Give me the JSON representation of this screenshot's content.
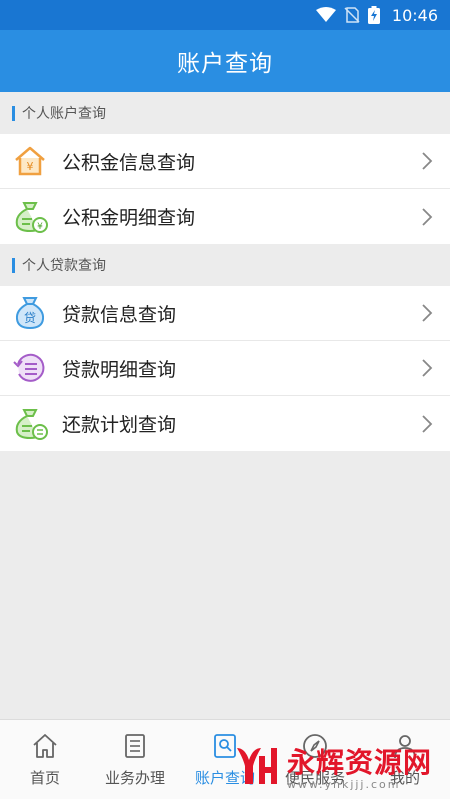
{
  "status_bar": {
    "time": "10:46"
  },
  "app_bar": {
    "title": "账户查询"
  },
  "sections": [
    {
      "title": "个人账户查询",
      "items": [
        {
          "label": "公积金信息查询",
          "icon": "house-yuan-icon"
        },
        {
          "label": "公积金明细查询",
          "icon": "money-bag-yuan-icon"
        }
      ]
    },
    {
      "title": "个人贷款查询",
      "items": [
        {
          "label": "贷款信息查询",
          "icon": "loan-bag-icon"
        },
        {
          "label": "贷款明细查询",
          "icon": "refresh-list-icon"
        },
        {
          "label": "还款计划查询",
          "icon": "repayment-bag-icon"
        }
      ]
    }
  ],
  "bottom_nav": {
    "items": [
      {
        "label": "首页",
        "icon": "home-icon"
      },
      {
        "label": "业务办理",
        "icon": "document-icon"
      },
      {
        "label": "账户查询",
        "icon": "account-search-icon",
        "active": true
      },
      {
        "label": "便民服务",
        "icon": "compass-icon"
      },
      {
        "label": "我的",
        "icon": "person-icon"
      }
    ]
  },
  "watermark": {
    "title": "永辉资源网",
    "subtitle": "www.yhkjjj.com"
  },
  "colors": {
    "primary": "#2a8ee2",
    "status_bar": "#1976d2",
    "watermark_red": "#e2162a"
  }
}
